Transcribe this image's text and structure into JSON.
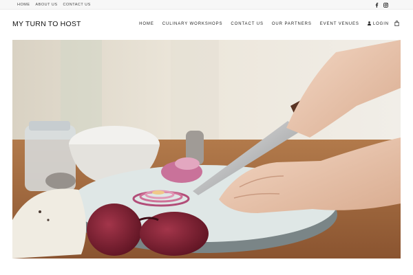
{
  "topbar": {
    "links": [
      {
        "label": "HOME"
      },
      {
        "label": "ABOUT US"
      },
      {
        "label": "CONTACT US"
      }
    ],
    "social": [
      "facebook-icon",
      "instagram-icon"
    ]
  },
  "header": {
    "logo": "MY TURN TO HOST",
    "nav": [
      {
        "label": "HOME"
      },
      {
        "label": "CULINARY WORKSHOPS"
      },
      {
        "label": "CONTACT US"
      },
      {
        "label": "OUR PARTNERS"
      },
      {
        "label": "EVENT VENUES"
      }
    ],
    "login_label": "LOGIN",
    "login_icon": "user-icon",
    "cart_icon": "shopping-bag-icon"
  },
  "hero": {
    "image_subject": "hands slicing red onion on a wooden board"
  },
  "colors": {
    "topbar_bg": "#f7f7f7",
    "text": "#1b1b1b",
    "onion": "#7a1f2c",
    "wood": "#a0643a"
  }
}
